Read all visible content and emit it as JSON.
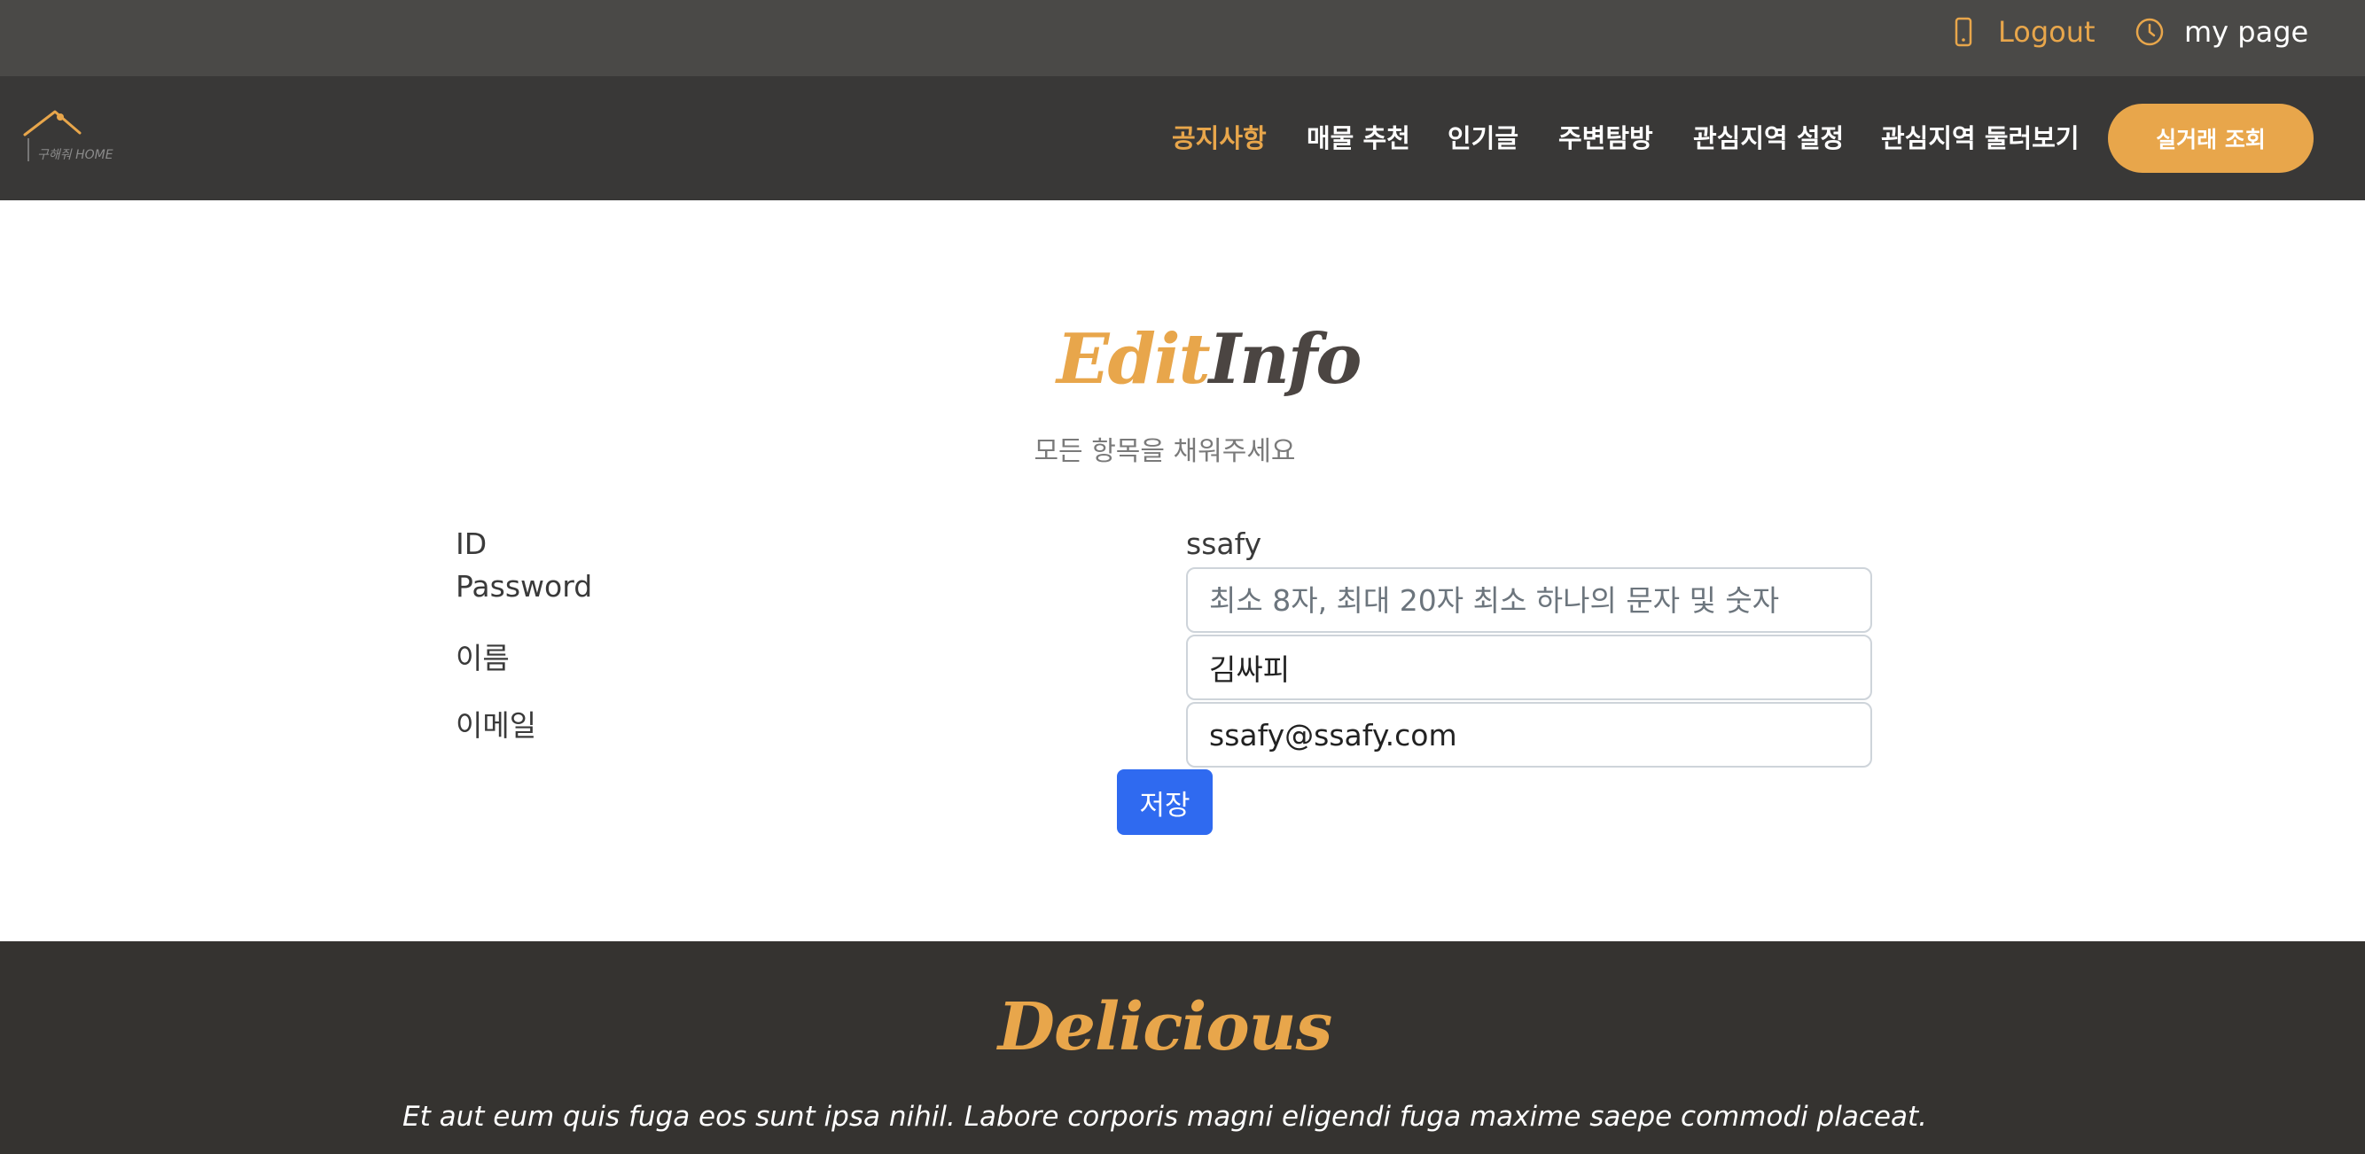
{
  "topbar": {
    "logout_label": "Logout",
    "mypage_label": "my page",
    "logout_icon": "phone-icon",
    "mypage_icon": "clock-icon"
  },
  "header": {
    "logo_text": "구해줘 HOME",
    "nav": [
      {
        "label": "공지사항",
        "active": true
      },
      {
        "label": "매물 추천"
      },
      {
        "label": "인기글"
      },
      {
        "label": "주변탐방"
      },
      {
        "label": "관심지역 설정"
      },
      {
        "label": "관심지역 둘러보기"
      }
    ],
    "cta_label": "실거래 조회"
  },
  "section": {
    "title_part1": "Edit",
    "title_part2": "Info",
    "subtitle": "모든 항목을 채워주세요"
  },
  "form": {
    "id_label": "ID",
    "id_value": "ssafy",
    "password_label": "Password",
    "password_placeholder": "최소 8자, 최대 20자 최소 하나의 문자 및 숫자",
    "name_label": "이름",
    "name_value": "김싸피",
    "email_label": "이메일",
    "email_value": "ssafy@ssafy.com",
    "save_label": "저장"
  },
  "footer": {
    "title": "Delicious",
    "text": "Et aut eum quis fuga eos sunt ipsa nihil. Labore corporis magni eligendi fuga maxime saepe commodi placeat."
  },
  "colors": {
    "accent": "#e8a64b",
    "topbar_bg": "#4a4947",
    "header_bg": "#393837",
    "footer_bg": "#353330",
    "save_button": "#2f6af0"
  }
}
